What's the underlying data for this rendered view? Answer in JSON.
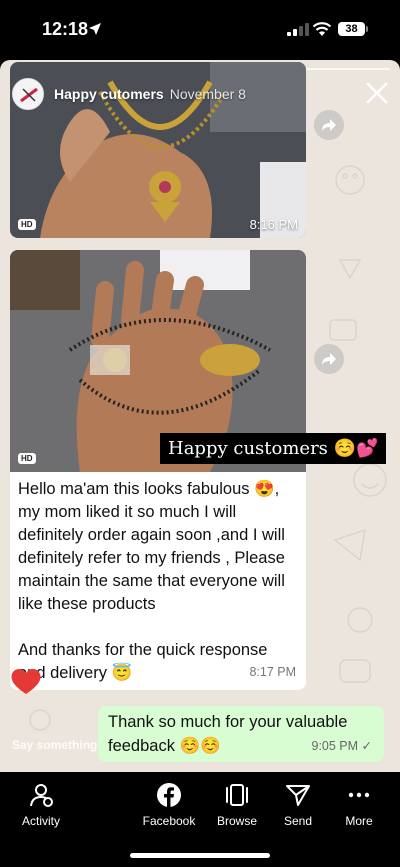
{
  "status": {
    "time": "12:18",
    "battery": "38"
  },
  "story": {
    "sender": "Happy cutomers",
    "date": "November 8",
    "photos": [
      {
        "hd": "HD",
        "time": "8:16 PM"
      },
      {
        "hd": "HD",
        "time": ""
      }
    ],
    "caption": "Happy customers ☺️💕",
    "message": "Hello ma'am this looks fabulous 😍, my mom liked it so much I will definitely order again soon ,and I will definitely refer to my friends , Please maintain the same that everyone will like these products\n\nAnd thanks for the quick response and delivery 😇",
    "message_time": "8:17 PM",
    "reply": "Thank so much for your valuable feedback ☺️☺️",
    "reply_time": "9:05 PM ✓",
    "say_placeholder": "Say something..."
  },
  "nav": {
    "activity": "Activity",
    "facebook": "Facebook",
    "browse": "Browse",
    "send": "Send",
    "more": "More"
  },
  "colors": {
    "reply_bubble": "#d9fdd3",
    "background": "#ece5dd",
    "heart": "#e53935"
  }
}
